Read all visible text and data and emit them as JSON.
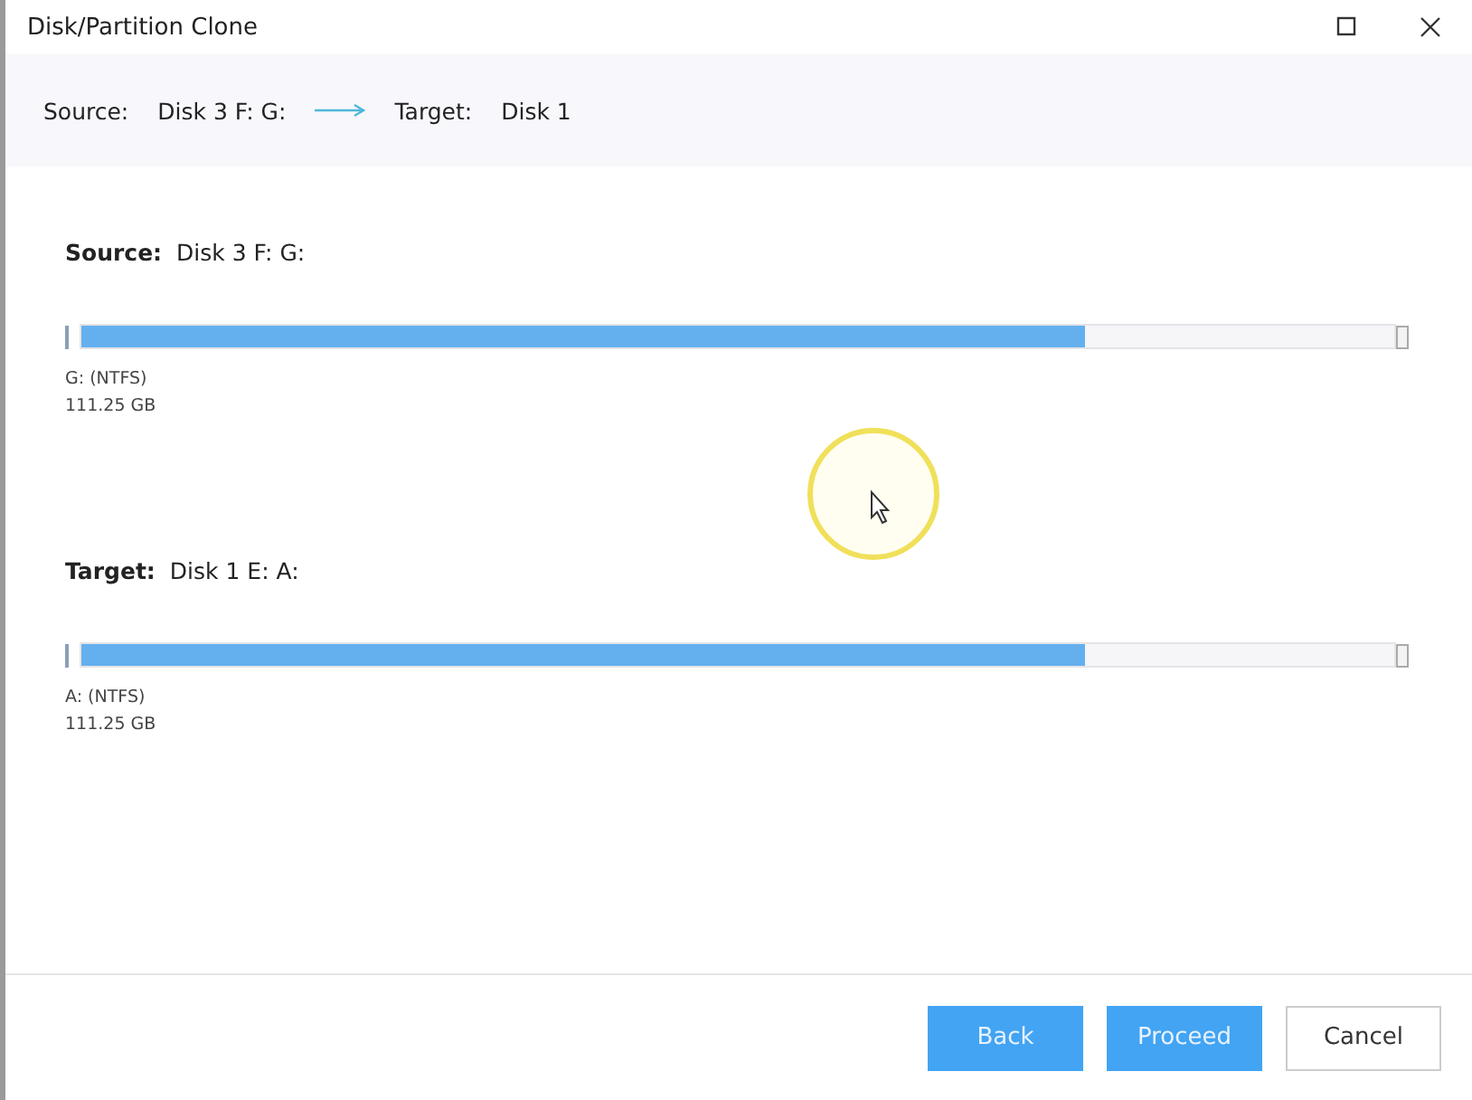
{
  "window": {
    "title": "Disk/Partition Clone"
  },
  "summary": {
    "source_label": "Source:",
    "source_value": "Disk 3 F: G:",
    "target_label": "Target:",
    "target_value": "Disk 1"
  },
  "disks": [
    {
      "label": "Source:",
      "name": "Disk 3 F: G:",
      "partition": "G: (NTFS)",
      "size": "111.25 GB",
      "level": 0.765
    },
    {
      "label": "Target:",
      "name": "Disk 1 E: A:",
      "partition": "A: (NTFS)",
      "size": "111.25 GB",
      "level": 0.765
    }
  ],
  "buttons": [
    {
      "label": "Back",
      "kind": "primary"
    },
    {
      "label": "Proceed",
      "kind": "primary"
    },
    {
      "label": "Cancel",
      "kind": "secondary"
    }
  ]
}
